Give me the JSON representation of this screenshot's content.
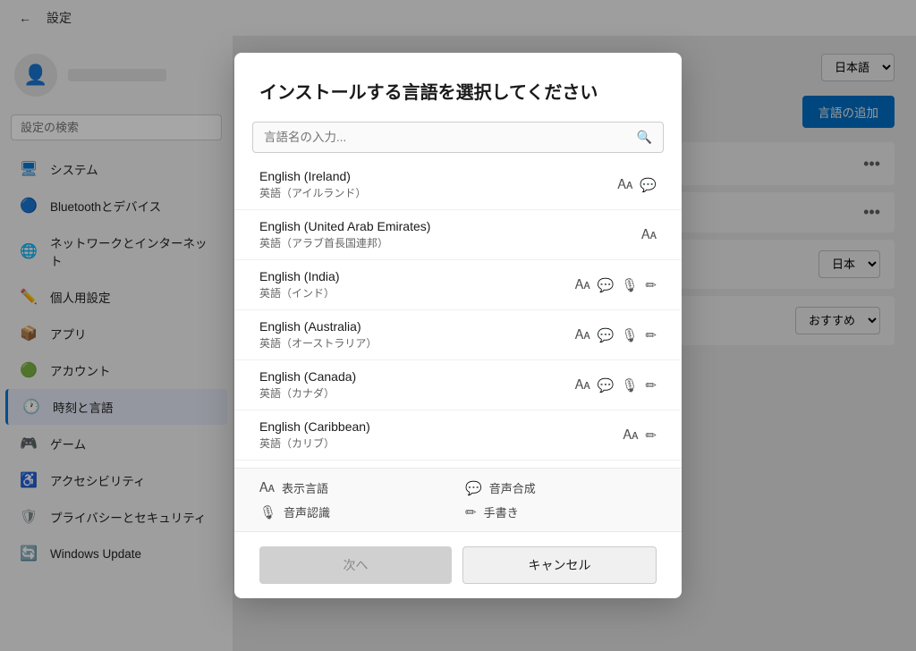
{
  "titlebar": {
    "back_label": "←",
    "title": "設定"
  },
  "sidebar": {
    "search_placeholder": "設定の検索",
    "items": [
      {
        "id": "system",
        "label": "システム",
        "icon": "🖥",
        "active": false
      },
      {
        "id": "bluetooth",
        "label": "Bluetoothとデバイス",
        "icon": "🔵",
        "active": false
      },
      {
        "id": "network",
        "label": "ネットワークとインターネット",
        "icon": "🌐",
        "active": false
      },
      {
        "id": "personalize",
        "label": "個人用設定",
        "icon": "✏",
        "active": false
      },
      {
        "id": "apps",
        "label": "アプリ",
        "icon": "📦",
        "active": false
      },
      {
        "id": "account",
        "label": "アカウント",
        "icon": "👤",
        "active": false
      },
      {
        "id": "time",
        "label": "時刻と言語",
        "icon": "🕐",
        "active": true
      },
      {
        "id": "gaming",
        "label": "ゲーム",
        "icon": "🎮",
        "active": false
      },
      {
        "id": "accessibility",
        "label": "アクセシビリティ",
        "icon": "♿",
        "active": false
      },
      {
        "id": "privacy",
        "label": "プライバシーとセキュリティ",
        "icon": "🛡",
        "active": false
      },
      {
        "id": "update",
        "label": "Windows Update",
        "icon": "🔄",
        "active": false
      }
    ]
  },
  "main": {
    "language_select_value": "日本語",
    "add_language_label": "言語の追加",
    "region_select_value": "日本",
    "sort_select_value": "おすすめ"
  },
  "dialog": {
    "title": "インストールする言語を選択してください",
    "search_placeholder": "言語名の入力...",
    "languages": [
      {
        "name": "English (Ireland)",
        "native": "英語（アイルランド）",
        "icons": [
          "display",
          "speech"
        ]
      },
      {
        "name": "English (United Arab Emirates)",
        "native": "英語（アラブ首長国連邦）",
        "icons": [
          "display"
        ]
      },
      {
        "name": "English (India)",
        "native": "英語（インド）",
        "icons": [
          "display",
          "speech",
          "voice",
          "handwrite"
        ]
      },
      {
        "name": "English (Australia)",
        "native": "英語（オーストラリア）",
        "icons": [
          "display",
          "speech",
          "voice",
          "handwrite"
        ]
      },
      {
        "name": "English (Canada)",
        "native": "英語（カナダ）",
        "icons": [
          "display",
          "speech",
          "voice",
          "handwrite"
        ]
      },
      {
        "name": "English (Caribbean)",
        "native": "英語（カリブ）",
        "icons": [
          "display",
          "handwrite"
        ]
      }
    ],
    "legend": [
      {
        "icon": "display",
        "label": "表示言語"
      },
      {
        "icon": "speech",
        "label": "音声合成"
      },
      {
        "icon": "voice",
        "label": "音声認識"
      },
      {
        "icon": "handwrite",
        "label": "手書き"
      }
    ],
    "btn_next": "次へ",
    "btn_cancel": "キャンセル"
  }
}
